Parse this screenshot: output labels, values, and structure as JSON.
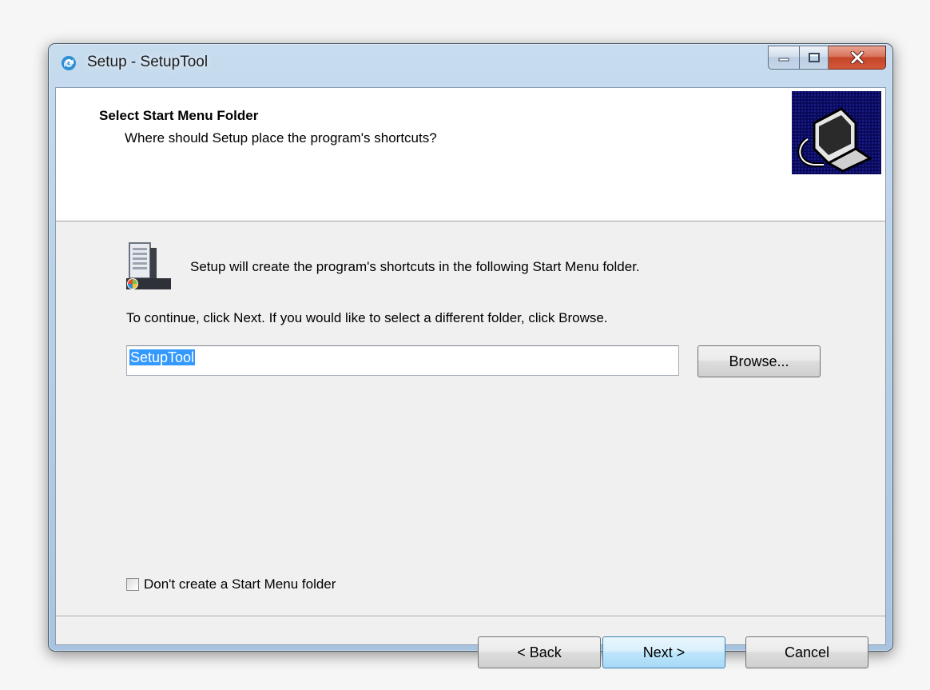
{
  "window": {
    "title": "Setup - SetupTool"
  },
  "header": {
    "title": "Select Start Menu Folder",
    "subtitle": "Where should Setup place the program's shortcuts?"
  },
  "body": {
    "info_text": "Setup will create the program's shortcuts in the following Start Menu folder.",
    "instruction_text": "To continue, click Next. If you would like to select a different folder, click Browse.",
    "folder_input_value": "SetupTool",
    "browse_label": "Browse...",
    "no_folder_checkbox_label": "Don't create a Start Menu folder",
    "no_folder_checked": false
  },
  "footer": {
    "back_label": "< Back",
    "next_label": "Next >",
    "cancel_label": "Cancel"
  },
  "icons": {
    "app": "setup-app-icon",
    "wizard": "computer-install-icon",
    "folder": "start-menu-folder-icon"
  }
}
